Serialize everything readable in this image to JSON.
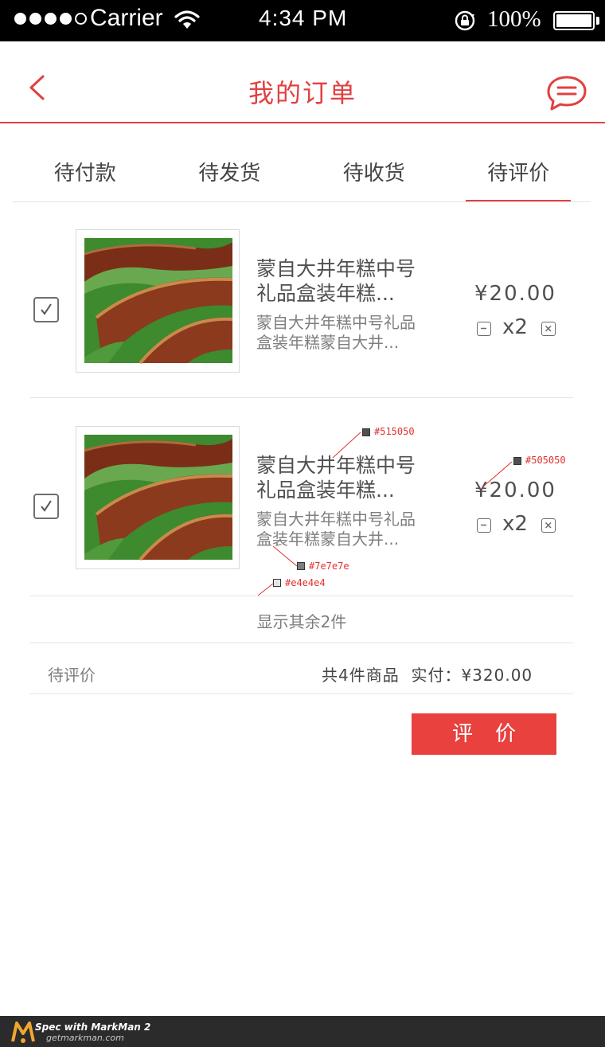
{
  "status_bar": {
    "carrier": "Carrier",
    "time": "4:34 PM",
    "battery": "100%"
  },
  "nav": {
    "title": "我的订单"
  },
  "tabs": [
    {
      "label": "待付款",
      "active": false
    },
    {
      "label": "待发货",
      "active": false
    },
    {
      "label": "待收货",
      "active": false
    },
    {
      "label": "待评价",
      "active": true
    }
  ],
  "items": [
    {
      "name_line1": "蒙自大井年糕中号",
      "name_line2": "礼品盒装年糕...",
      "desc_line1": "蒙自大井年糕中号礼品",
      "desc_line2": "盒装年糕蒙自大井...",
      "price": "¥20.00",
      "qty": "x2",
      "checked": true
    },
    {
      "name_line1": "蒙自大井年糕中号",
      "name_line2": "礼品盒装年糕...",
      "desc_line1": "蒙自大井年糕中号礼品",
      "desc_line2": "盒装年糕蒙自大井...",
      "price": "¥20.00",
      "qty": "x2",
      "checked": true
    }
  ],
  "show_more": "显示其余2件",
  "order": {
    "status": "待评价",
    "summary": "共4件商品  实付：¥320.00"
  },
  "review_button": "评价",
  "annotations": {
    "name_color": "#515050",
    "price_color": "#505050",
    "desc_color": "#7e7e7e",
    "divider_color": "#e4e4e4"
  },
  "footer": {
    "brand": "Spec with MarkMan 2",
    "url": "getmarkman.com"
  },
  "colors": {
    "accent": "#e24040",
    "button": "#e8413e"
  }
}
